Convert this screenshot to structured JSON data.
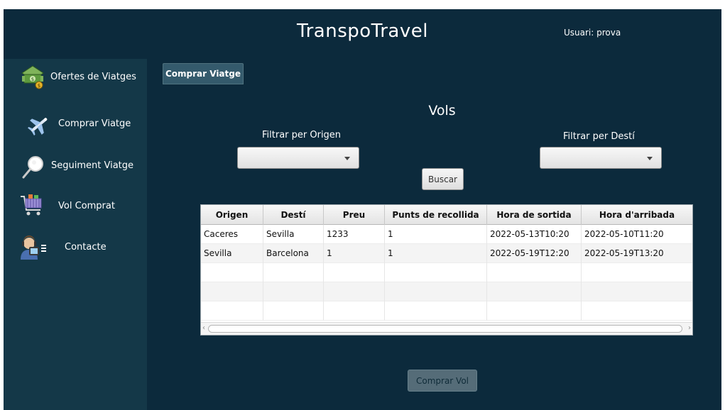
{
  "header": {
    "title": "TranspoTravel",
    "user": "Usuari: prova"
  },
  "sidebar": {
    "items": [
      {
        "label": "Ofertes de Viatges",
        "icon": "money-icon"
      },
      {
        "label": "Comprar Viatge",
        "icon": "airplane-icon"
      },
      {
        "label": "Seguiment Viatge",
        "icon": "magnifier-icon"
      },
      {
        "label": "Vol Comprat",
        "icon": "shopping-cart-icon"
      },
      {
        "label": "Contacte",
        "icon": "support-agent-icon"
      }
    ]
  },
  "main": {
    "tab": "Comprar Viatge",
    "section_title": "Vols",
    "filter_origin_label": "Filtrar per Origen",
    "filter_dest_label": "Filtrar per Destí",
    "filter_origin_value": "",
    "filter_dest_value": "",
    "search_button": "Buscar",
    "buy_button": "Comprar Vol"
  },
  "table": {
    "columns": [
      "Origen",
      "Destí",
      "Preu",
      "Punts de recollida",
      "Hora de sortida",
      "Hora d'arribada"
    ],
    "rows": [
      [
        "Caceres",
        "Sevilla",
        "1233",
        "1",
        "2022-05-13T10:20",
        "2022-05-10T11:20"
      ],
      [
        "Sevilla",
        "Barcelona",
        "1",
        "1",
        "2022-05-19T12:20",
        "2022-05-19T13:20"
      ]
    ]
  },
  "colors": {
    "header_bg": "#0c2a3c",
    "sidebar_bg": "#143848",
    "main_bg": "#0c2a3c"
  }
}
